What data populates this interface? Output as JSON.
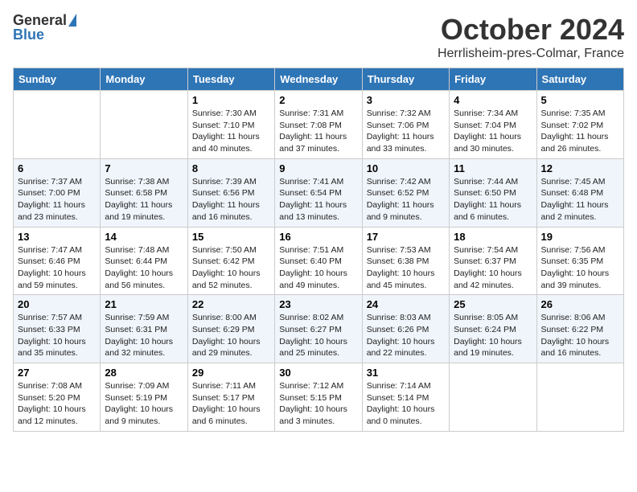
{
  "logo": {
    "general": "General",
    "blue": "Blue"
  },
  "title": "October 2024",
  "location": "Herrlisheim-pres-Colmar, France",
  "header_days": [
    "Sunday",
    "Monday",
    "Tuesday",
    "Wednesday",
    "Thursday",
    "Friday",
    "Saturday"
  ],
  "weeks": [
    [
      {
        "day": "",
        "sunrise": "",
        "sunset": "",
        "daylight": ""
      },
      {
        "day": "",
        "sunrise": "",
        "sunset": "",
        "daylight": ""
      },
      {
        "day": "1",
        "sunrise": "Sunrise: 7:30 AM",
        "sunset": "Sunset: 7:10 PM",
        "daylight": "Daylight: 11 hours and 40 minutes."
      },
      {
        "day": "2",
        "sunrise": "Sunrise: 7:31 AM",
        "sunset": "Sunset: 7:08 PM",
        "daylight": "Daylight: 11 hours and 37 minutes."
      },
      {
        "day": "3",
        "sunrise": "Sunrise: 7:32 AM",
        "sunset": "Sunset: 7:06 PM",
        "daylight": "Daylight: 11 hours and 33 minutes."
      },
      {
        "day": "4",
        "sunrise": "Sunrise: 7:34 AM",
        "sunset": "Sunset: 7:04 PM",
        "daylight": "Daylight: 11 hours and 30 minutes."
      },
      {
        "day": "5",
        "sunrise": "Sunrise: 7:35 AM",
        "sunset": "Sunset: 7:02 PM",
        "daylight": "Daylight: 11 hours and 26 minutes."
      }
    ],
    [
      {
        "day": "6",
        "sunrise": "Sunrise: 7:37 AM",
        "sunset": "Sunset: 7:00 PM",
        "daylight": "Daylight: 11 hours and 23 minutes."
      },
      {
        "day": "7",
        "sunrise": "Sunrise: 7:38 AM",
        "sunset": "Sunset: 6:58 PM",
        "daylight": "Daylight: 11 hours and 19 minutes."
      },
      {
        "day": "8",
        "sunrise": "Sunrise: 7:39 AM",
        "sunset": "Sunset: 6:56 PM",
        "daylight": "Daylight: 11 hours and 16 minutes."
      },
      {
        "day": "9",
        "sunrise": "Sunrise: 7:41 AM",
        "sunset": "Sunset: 6:54 PM",
        "daylight": "Daylight: 11 hours and 13 minutes."
      },
      {
        "day": "10",
        "sunrise": "Sunrise: 7:42 AM",
        "sunset": "Sunset: 6:52 PM",
        "daylight": "Daylight: 11 hours and 9 minutes."
      },
      {
        "day": "11",
        "sunrise": "Sunrise: 7:44 AM",
        "sunset": "Sunset: 6:50 PM",
        "daylight": "Daylight: 11 hours and 6 minutes."
      },
      {
        "day": "12",
        "sunrise": "Sunrise: 7:45 AM",
        "sunset": "Sunset: 6:48 PM",
        "daylight": "Daylight: 11 hours and 2 minutes."
      }
    ],
    [
      {
        "day": "13",
        "sunrise": "Sunrise: 7:47 AM",
        "sunset": "Sunset: 6:46 PM",
        "daylight": "Daylight: 10 hours and 59 minutes."
      },
      {
        "day": "14",
        "sunrise": "Sunrise: 7:48 AM",
        "sunset": "Sunset: 6:44 PM",
        "daylight": "Daylight: 10 hours and 56 minutes."
      },
      {
        "day": "15",
        "sunrise": "Sunrise: 7:50 AM",
        "sunset": "Sunset: 6:42 PM",
        "daylight": "Daylight: 10 hours and 52 minutes."
      },
      {
        "day": "16",
        "sunrise": "Sunrise: 7:51 AM",
        "sunset": "Sunset: 6:40 PM",
        "daylight": "Daylight: 10 hours and 49 minutes."
      },
      {
        "day": "17",
        "sunrise": "Sunrise: 7:53 AM",
        "sunset": "Sunset: 6:38 PM",
        "daylight": "Daylight: 10 hours and 45 minutes."
      },
      {
        "day": "18",
        "sunrise": "Sunrise: 7:54 AM",
        "sunset": "Sunset: 6:37 PM",
        "daylight": "Daylight: 10 hours and 42 minutes."
      },
      {
        "day": "19",
        "sunrise": "Sunrise: 7:56 AM",
        "sunset": "Sunset: 6:35 PM",
        "daylight": "Daylight: 10 hours and 39 minutes."
      }
    ],
    [
      {
        "day": "20",
        "sunrise": "Sunrise: 7:57 AM",
        "sunset": "Sunset: 6:33 PM",
        "daylight": "Daylight: 10 hours and 35 minutes."
      },
      {
        "day": "21",
        "sunrise": "Sunrise: 7:59 AM",
        "sunset": "Sunset: 6:31 PM",
        "daylight": "Daylight: 10 hours and 32 minutes."
      },
      {
        "day": "22",
        "sunrise": "Sunrise: 8:00 AM",
        "sunset": "Sunset: 6:29 PM",
        "daylight": "Daylight: 10 hours and 29 minutes."
      },
      {
        "day": "23",
        "sunrise": "Sunrise: 8:02 AM",
        "sunset": "Sunset: 6:27 PM",
        "daylight": "Daylight: 10 hours and 25 minutes."
      },
      {
        "day": "24",
        "sunrise": "Sunrise: 8:03 AM",
        "sunset": "Sunset: 6:26 PM",
        "daylight": "Daylight: 10 hours and 22 minutes."
      },
      {
        "day": "25",
        "sunrise": "Sunrise: 8:05 AM",
        "sunset": "Sunset: 6:24 PM",
        "daylight": "Daylight: 10 hours and 19 minutes."
      },
      {
        "day": "26",
        "sunrise": "Sunrise: 8:06 AM",
        "sunset": "Sunset: 6:22 PM",
        "daylight": "Daylight: 10 hours and 16 minutes."
      }
    ],
    [
      {
        "day": "27",
        "sunrise": "Sunrise: 7:08 AM",
        "sunset": "Sunset: 5:20 PM",
        "daylight": "Daylight: 10 hours and 12 minutes."
      },
      {
        "day": "28",
        "sunrise": "Sunrise: 7:09 AM",
        "sunset": "Sunset: 5:19 PM",
        "daylight": "Daylight: 10 hours and 9 minutes."
      },
      {
        "day": "29",
        "sunrise": "Sunrise: 7:11 AM",
        "sunset": "Sunset: 5:17 PM",
        "daylight": "Daylight: 10 hours and 6 minutes."
      },
      {
        "day": "30",
        "sunrise": "Sunrise: 7:12 AM",
        "sunset": "Sunset: 5:15 PM",
        "daylight": "Daylight: 10 hours and 3 minutes."
      },
      {
        "day": "31",
        "sunrise": "Sunrise: 7:14 AM",
        "sunset": "Sunset: 5:14 PM",
        "daylight": "Daylight: 10 hours and 0 minutes."
      },
      {
        "day": "",
        "sunrise": "",
        "sunset": "",
        "daylight": ""
      },
      {
        "day": "",
        "sunrise": "",
        "sunset": "",
        "daylight": ""
      }
    ]
  ]
}
